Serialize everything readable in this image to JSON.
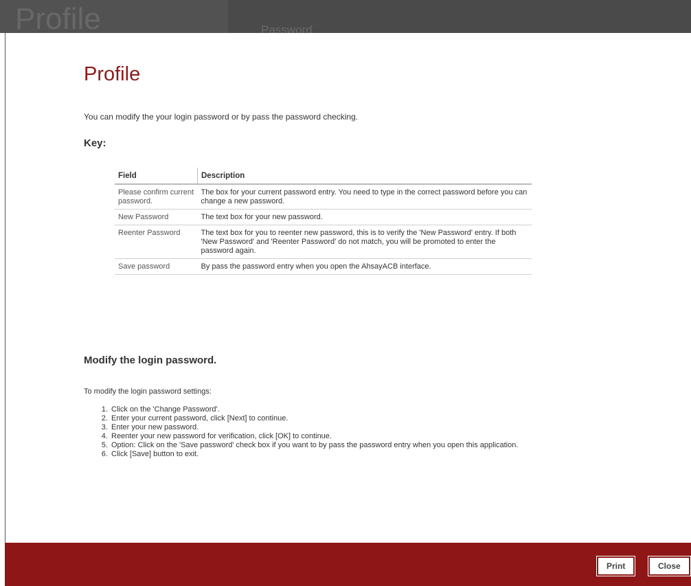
{
  "background": {
    "title": "Profile",
    "tab": "Password"
  },
  "page": {
    "title": "Profile",
    "intro": "You can modify the your login password or by pass the password checking.",
    "key_heading": "Key:"
  },
  "table": {
    "headers": [
      "Field",
      "Description"
    ],
    "rows": [
      {
        "field": "Please confirm current password.",
        "description": "The box for your current password entry. You need to type in the correct password before you can change a new password."
      },
      {
        "field": "New Password",
        "description": "The text box for your new password."
      },
      {
        "field": "Reenter Password",
        "description": "The text box for you to reenter new password, this is to verify the 'New Password' entry. If both 'New Password' and 'Reenter Password' do not match, you will be promoted to enter the password again."
      },
      {
        "field": "Save password",
        "description": "By pass the password entry when you open the AhsayACB interface."
      }
    ]
  },
  "modify": {
    "heading": "Modify the login password.",
    "intro": "To modify the login password settings:",
    "steps": [
      "Click on the 'Change Password'.",
      "Enter your current password, click [Next] to continue.",
      "Enter your new password.",
      "Reenter your new password for verification, click [OK] to continue.",
      "Option: Click on the 'Save password' check box if you want to by pass the password entry when you open this application.",
      "Click [Save] button to exit."
    ]
  },
  "footer": {
    "print_label": "Print",
    "close_label": "Close"
  },
  "colors": {
    "accent": "#8e1616",
    "title": "#8b1a1a"
  }
}
